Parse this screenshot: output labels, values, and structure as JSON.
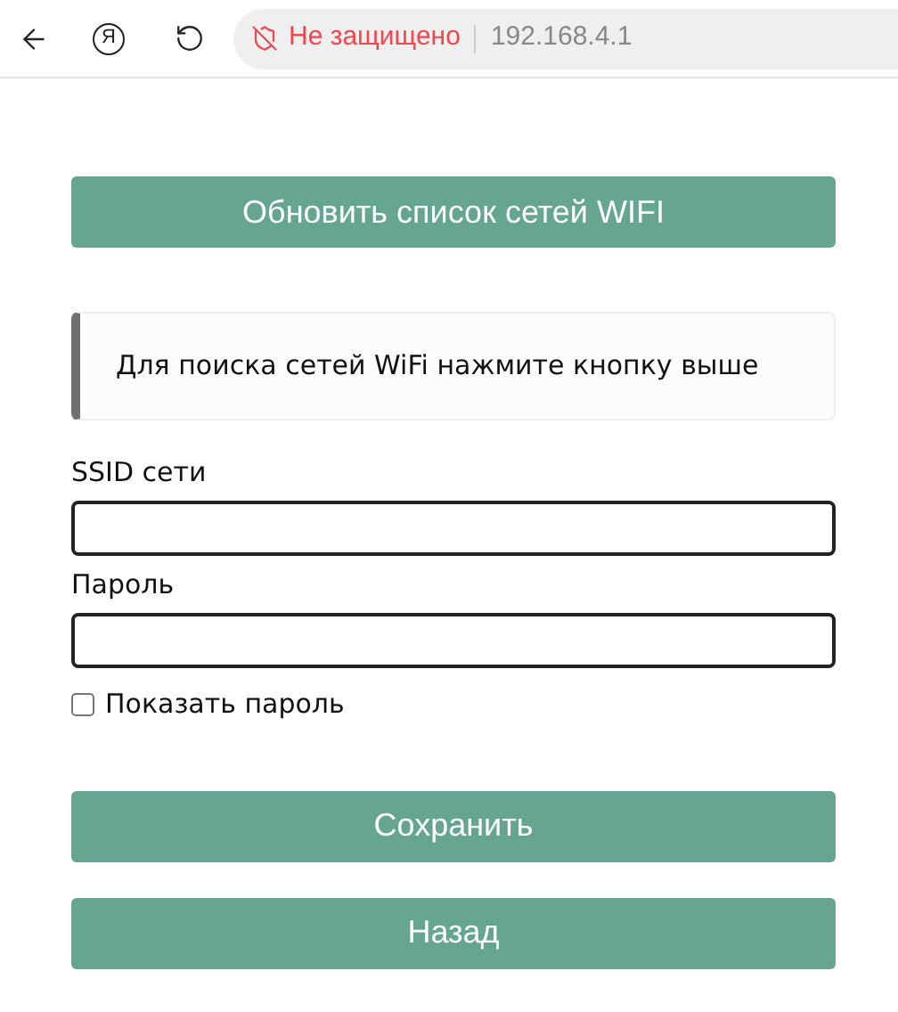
{
  "browser": {
    "logo_glyph": "Я",
    "security": "Не защищено",
    "address": "192.168.4.1"
  },
  "refresh_button": "Обновить список сетей WIFI",
  "notice": "Для поиска сетей WiFi нажмите кнопку выше",
  "fields": [
    {
      "label": "SSID сети"
    },
    {
      "label": "Пароль"
    }
  ],
  "show_password": {
    "label": "Показать пароль",
    "checked": false
  },
  "buttons": [
    "Сохранить",
    "Назад"
  ]
}
